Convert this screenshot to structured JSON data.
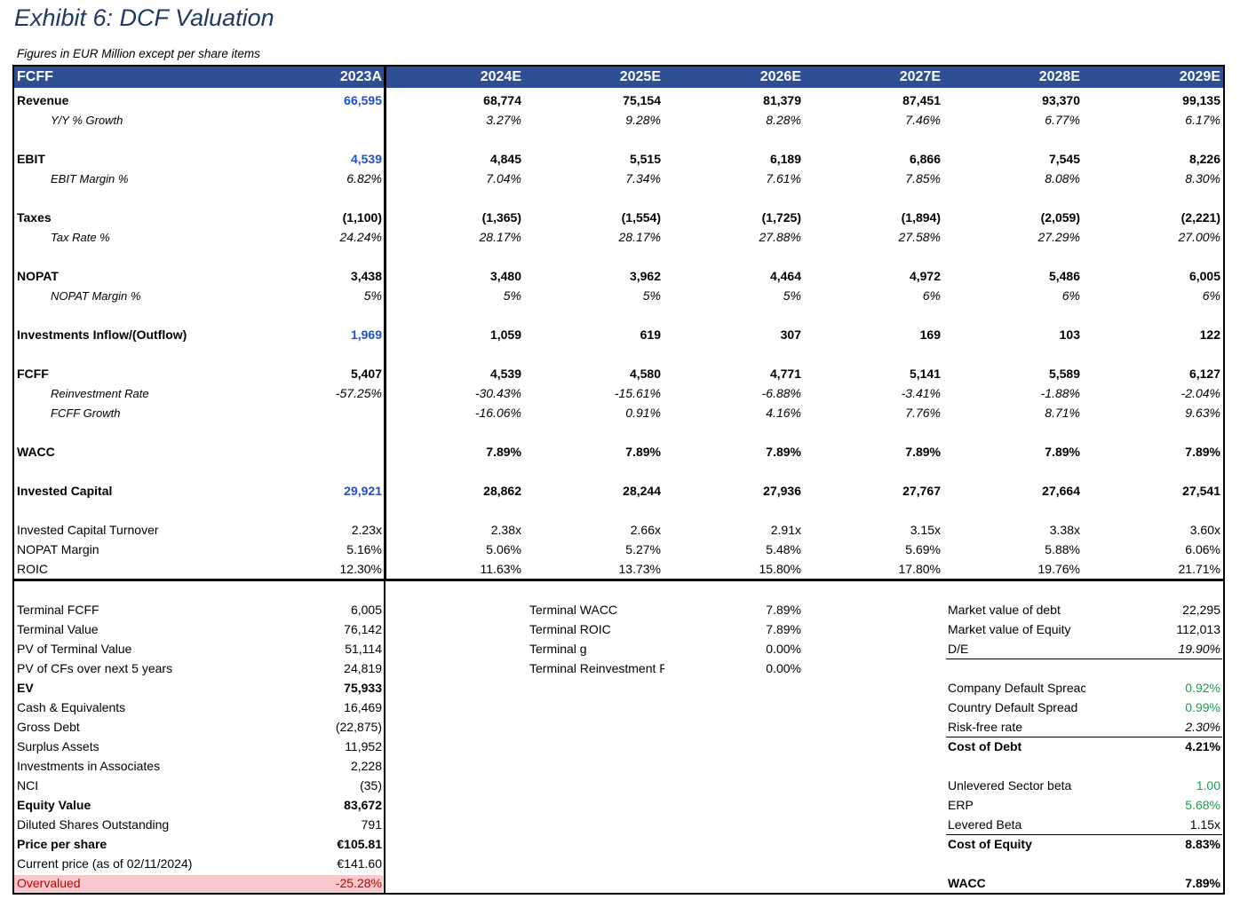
{
  "title": "Exhibit 6: DCF Valuation",
  "subtitle": "Figures in EUR Million except per share items",
  "colors": {
    "header_bg": "#2f4f93",
    "header_text": "#ffffff",
    "blue_input": "#1f4fd1",
    "green_input": "#12a34a",
    "overvalued_bg": "#f8c9cc",
    "overvalued_text": "#c00000"
  },
  "table": {
    "header_label": "FCFF",
    "years": [
      "2023A",
      "2024E",
      "2025E",
      "2026E",
      "2027E",
      "2028E",
      "2029E"
    ],
    "rows": [
      {
        "label": "Revenue",
        "values": [
          "66,595",
          "68,774",
          "75,154",
          "81,379",
          "87,451",
          "93,370",
          "99,135"
        ]
      },
      {
        "label": "Y/Y % Growth",
        "values": [
          "",
          "3.27%",
          "9.28%",
          "8.28%",
          "7.46%",
          "6.77%",
          "6.17%"
        ]
      },
      {
        "label": "EBIT",
        "values": [
          "4,539",
          "4,845",
          "5,515",
          "6,189",
          "6,866",
          "7,545",
          "8,226"
        ]
      },
      {
        "label": "EBIT Margin %",
        "values": [
          "6.82%",
          "7.04%",
          "7.34%",
          "7.61%",
          "7.85%",
          "8.08%",
          "8.30%"
        ]
      },
      {
        "label": "Taxes",
        "values": [
          "(1,100)",
          "(1,365)",
          "(1,554)",
          "(1,725)",
          "(1,894)",
          "(2,059)",
          "(2,221)"
        ]
      },
      {
        "label": "Tax Rate %",
        "values": [
          "24.24%",
          "28.17%",
          "28.17%",
          "27.88%",
          "27.58%",
          "27.29%",
          "27.00%"
        ]
      },
      {
        "label": "NOPAT",
        "values": [
          "3,438",
          "3,480",
          "3,962",
          "4,464",
          "4,972",
          "5,486",
          "6,005"
        ]
      },
      {
        "label": "NOPAT Margin %",
        "values": [
          "5%",
          "5%",
          "5%",
          "5%",
          "6%",
          "6%",
          "6%"
        ]
      },
      {
        "label": "Investments Inflow/(Outflow)",
        "values": [
          "1,969",
          "1,059",
          "619",
          "307",
          "169",
          "103",
          "122"
        ]
      },
      {
        "label": "FCFF",
        "values": [
          "5,407",
          "4,539",
          "4,580",
          "4,771",
          "5,141",
          "5,589",
          "6,127"
        ]
      },
      {
        "label": "Reinvestment Rate",
        "values": [
          "-57.25%",
          "-30.43%",
          "-15.61%",
          "-6.88%",
          "-3.41%",
          "-1.88%",
          "-2.04%"
        ]
      },
      {
        "label": "FCFF Growth",
        "values": [
          "",
          "-16.06%",
          "0.91%",
          "4.16%",
          "7.76%",
          "8.71%",
          "9.63%"
        ]
      },
      {
        "label": "WACC",
        "values": [
          "",
          "7.89%",
          "7.89%",
          "7.89%",
          "7.89%",
          "7.89%",
          "7.89%"
        ]
      },
      {
        "label": "Invested Capital",
        "values": [
          "29,921",
          "28,862",
          "28,244",
          "27,936",
          "27,767",
          "27,664",
          "27,541"
        ]
      },
      {
        "label": "Invested Capital Turnover",
        "values": [
          "2.23x",
          "2.38x",
          "2.66x",
          "2.91x",
          "3.15x",
          "3.38x",
          "3.60x"
        ]
      },
      {
        "label": "NOPAT Margin",
        "values": [
          "5.16%",
          "5.06%",
          "5.27%",
          "5.48%",
          "5.69%",
          "5.88%",
          "6.06%"
        ]
      },
      {
        "label": "ROIC",
        "values": [
          "12.30%",
          "11.63%",
          "13.73%",
          "15.80%",
          "17.80%",
          "19.76%",
          "21.71%"
        ]
      }
    ]
  },
  "valuation": [
    {
      "label": "Terminal FCFF",
      "value": "6,005"
    },
    {
      "label": "Terminal Value",
      "value": "76,142"
    },
    {
      "label": "PV of Terminal Value",
      "value": "51,114"
    },
    {
      "label": "PV of CFs over next 5 years",
      "value": "24,819"
    },
    {
      "label": "EV",
      "value": "75,933"
    },
    {
      "label": "Cash & Equivalents",
      "value": "16,469"
    },
    {
      "label": "Gross Debt",
      "value": "(22,875)"
    },
    {
      "label": "Surplus Assets",
      "value": "11,952"
    },
    {
      "label": "Investments in Associates",
      "value": "2,228"
    },
    {
      "label": "NCI",
      "value": "(35)"
    },
    {
      "label": "Equity Value",
      "value": "83,672"
    },
    {
      "label": "Diluted Shares Outstanding",
      "value": "791"
    },
    {
      "label": "Price per share",
      "value": "€105.81"
    },
    {
      "label": "Current price (as of 02/11/2024)",
      "value": "€141.60"
    },
    {
      "label": "Overvalued",
      "value": "-25.28%"
    }
  ],
  "terminal": [
    {
      "label": "Terminal WACC",
      "value": "7.89%"
    },
    {
      "label": "Terminal ROIC",
      "value": "7.89%"
    },
    {
      "label": "Terminal g",
      "value": "0.00%"
    },
    {
      "label": "Terminal Reinvestment F",
      "value": "0.00%"
    }
  ],
  "wacc_calc": [
    {
      "label": "Market value of debt",
      "value": "22,295"
    },
    {
      "label": "Market value of Equity",
      "value": "112,013"
    },
    {
      "label": "D/E",
      "value": "19.90%"
    },
    {
      "label": "Company Default Spreac",
      "value": "0.92%"
    },
    {
      "label": "Country Default Spread",
      "value": "0.99%"
    },
    {
      "label": "Risk-free rate",
      "value": "2.30%"
    },
    {
      "label": "Cost of Debt",
      "value": "4.21%"
    },
    {
      "label": "Unlevered Sector beta",
      "value": "1.00"
    },
    {
      "label": "ERP",
      "value": "5.68%"
    },
    {
      "label": "Levered Beta",
      "value": "1.15x"
    },
    {
      "label": "Cost of Equity",
      "value": "8.83%"
    },
    {
      "label": "WACC",
      "value": "7.89%"
    }
  ]
}
